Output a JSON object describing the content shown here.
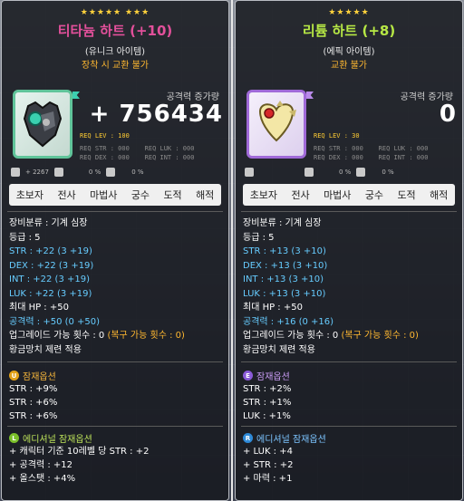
{
  "left": {
    "stars": "★★★★★ ★★★",
    "name": "티타늄 하트 (+10)",
    "rarity": "(유니크 아이템)",
    "trade": "장착 시 교환 불가",
    "atk_label": "공격력 증가량",
    "atk_value": "+ 756434",
    "req_lev": "REQ LEV : 100",
    "req_row1": "REQ STR : 000    REQ LUK : 000",
    "req_row2": "REQ DEX : 000    REQ INT : 000",
    "mini_value": "+ 2267",
    "mini_pct1": "0 %",
    "mini_pct2": "0 %",
    "jobs": [
      "초보자",
      "전사",
      "마법사",
      "궁수",
      "도적",
      "해적"
    ],
    "category": "장비분류 : 기계 심장",
    "grade": "등급 : 5",
    "str": "STR : +22 (3 +19)",
    "dex": "DEX : +22 (3 +19)",
    "int": "INT : +22 (3 +19)",
    "luk": "LUK : +22 (3 +19)",
    "hp": "최대 HP : +50",
    "atk": "공격력 : +50 (0 +50)",
    "upgrade": "업그레이드 가능 횟수 : 0",
    "recover": "(복구 가능 횟수 : 0)",
    "hammer": "황금망치 제련 적용",
    "pot_badge": "U",
    "pot_title": "잠재옵션",
    "pot_lines": [
      "STR : +9%",
      "STR : +6%",
      "STR : +6%"
    ],
    "add_badge": "L",
    "add_title": "에디셔널 잠재옵션",
    "add_lines": [
      "+ 캐릭터 기준 10레벨 당 STR : +2",
      "+ 공격력 : +12",
      "+ 올스탯 : +4%"
    ]
  },
  "right": {
    "stars": "★★★★★",
    "name": "리튬 하트 (+8)",
    "rarity": "(에픽 아이템)",
    "trade": "교환 불가",
    "atk_label": "공격력 증가량",
    "atk_value": "0",
    "req_lev": "REQ LEV :  30",
    "req_row1": "REQ STR : 000    REQ LUK : 000",
    "req_row2": "REQ DEX : 000    REQ INT : 000",
    "mini_pct1": "0 %",
    "mini_pct2": "0 %",
    "jobs": [
      "초보자",
      "전사",
      "마법사",
      "궁수",
      "도적",
      "해적"
    ],
    "category": "장비분류 : 기계 심장",
    "grade": "등급 : 5",
    "str": "STR : +13 (3 +10)",
    "dex": "DEX : +13 (3 +10)",
    "int": "INT : +13 (3 +10)",
    "luk": "LUK : +13 (3 +10)",
    "hp": "최대 HP : +50",
    "atk": "공격력 : +16 (0 +16)",
    "upgrade": "업그레이드 가능 횟수 : 0",
    "recover": "(복구 가능 횟수 : 0)",
    "hammer": "황금망치 제련 적용",
    "pot_badge": "E",
    "pot_title": "잠재옵션",
    "pot_lines": [
      "STR : +2%",
      "STR : +1%",
      "LUK : +1%"
    ],
    "add_badge": "R",
    "add_title": "에디셔널 잠재옵션",
    "add_lines": [
      "+ LUK : +4",
      "+ STR : +2",
      "+ 마력 : +1"
    ]
  },
  "colors": {
    "unique": "#e3509b",
    "epic": "#b7e845",
    "stat_blue": "#66ccff",
    "orange": "#ffb830"
  }
}
